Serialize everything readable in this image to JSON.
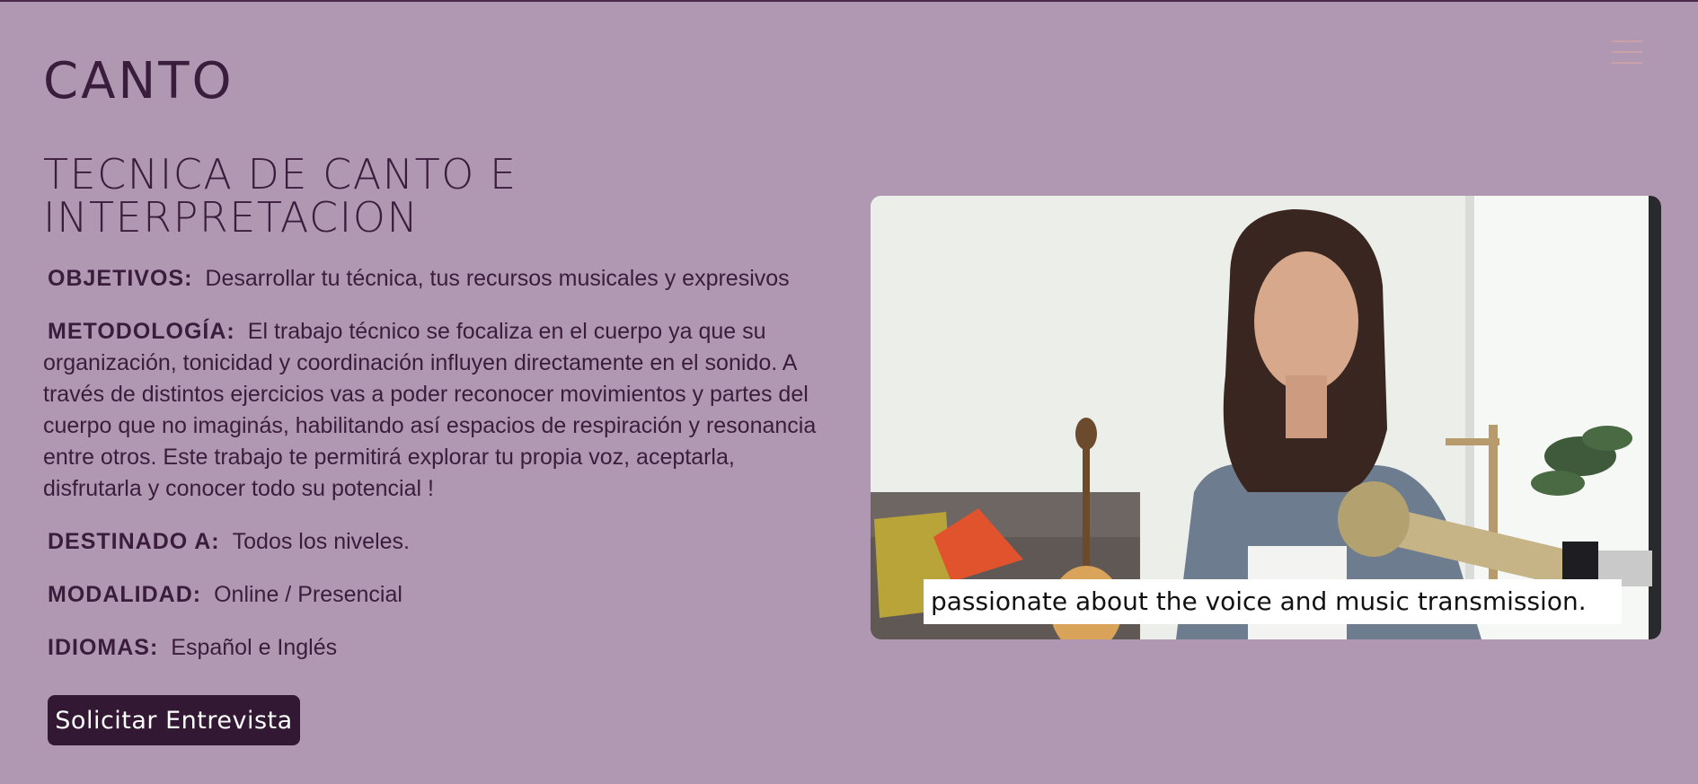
{
  "site": {
    "title": "CANTO"
  },
  "course": {
    "headline": "TECNICA DE CANTO E INTERPRETACION"
  },
  "info": {
    "objetivos": {
      "label": "OBJETIVOS:",
      "text": "Desarrollar tu técnica, tus recursos musicales y expresivos"
    },
    "metodologia": {
      "label": "METODOLOGÍA:",
      "text": "El trabajo técnico se focaliza en el cuerpo ya que su organización, tonicidad y coordinación influyen directamente en el sonido. A través de distintos ejercicios vas a poder reconocer movimientos y partes del cuerpo que no imaginás, habilitando así espacios de respiración y resonancia entre otros. Este trabajo te permitirá explorar tu propia voz, aceptarla, disfrutarla y conocer todo su potencial !"
    },
    "destinado": {
      "label": "DESTINADO A:",
      "text": "Todos los niveles."
    },
    "modalidad": {
      "label": "MODALIDAD:",
      "text": "Online / Presencial"
    },
    "idiomas": {
      "label": "IDIOMAS:",
      "text": "Español e Inglés"
    }
  },
  "cta": {
    "label": "Solicitar Entrevista"
  },
  "video": {
    "caption": "passionate about the voice and music transmission."
  },
  "icons": {
    "menu": "hamburger-menu-icon"
  },
  "colors": {
    "background": "#b098b2",
    "text": "#3a1d3c",
    "button": "#331833",
    "menu_icon": "#c9a2a8"
  }
}
